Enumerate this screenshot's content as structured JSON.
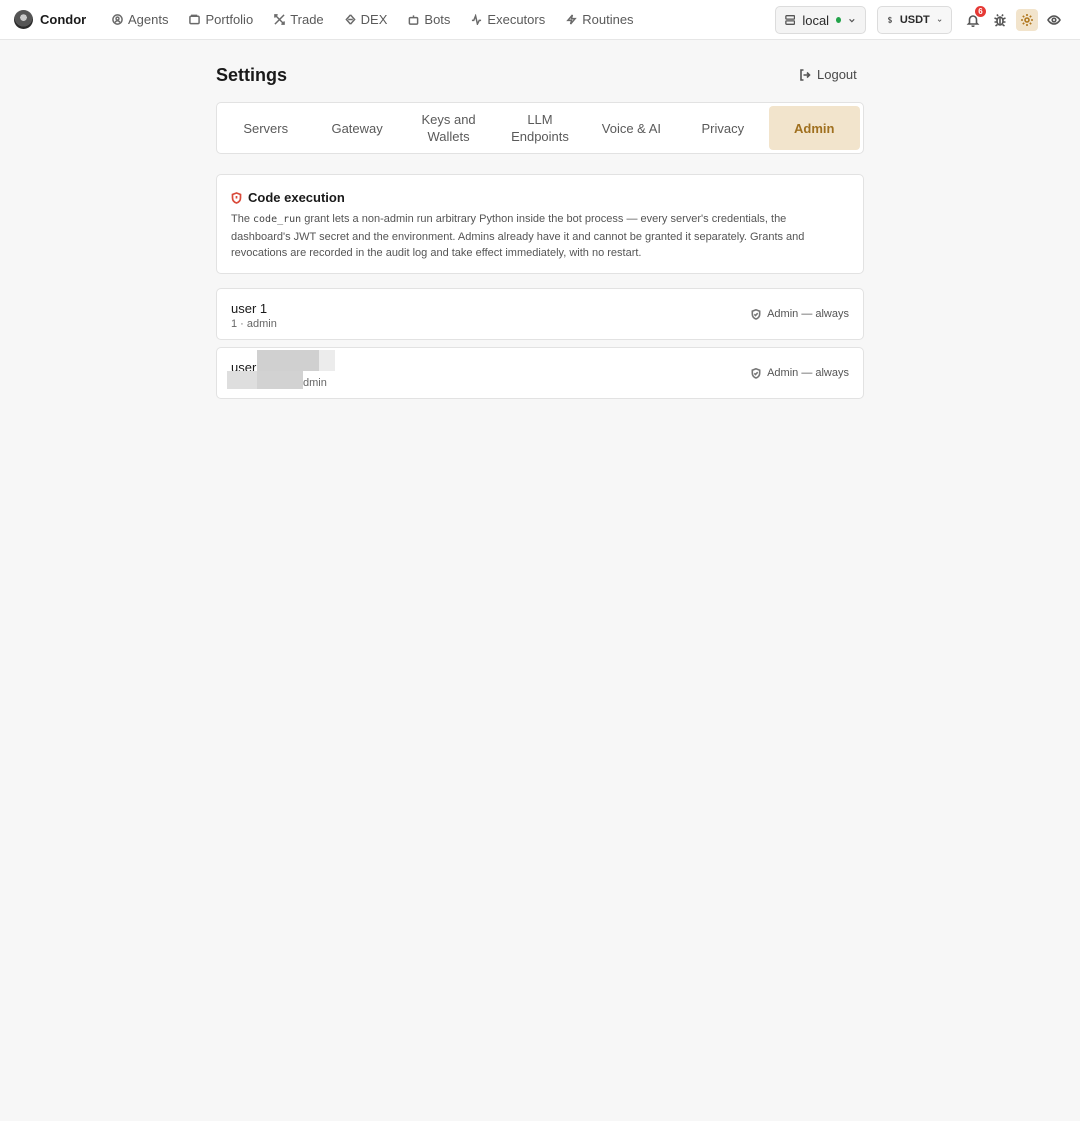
{
  "app": {
    "brand": "Condor"
  },
  "nav": {
    "items": [
      {
        "label": "Agents",
        "icon": "agents-icon"
      },
      {
        "label": "Portfolio",
        "icon": "portfolio-icon"
      },
      {
        "label": "Trade",
        "icon": "trade-icon"
      },
      {
        "label": "DEX",
        "icon": "dex-icon"
      },
      {
        "label": "Bots",
        "icon": "bots-icon"
      },
      {
        "label": "Executors",
        "icon": "executors-icon"
      },
      {
        "label": "Routines",
        "icon": "routines-icon"
      }
    ],
    "server": {
      "label": "local",
      "status_color": "#22a34a"
    },
    "currency": {
      "label": "USDT"
    },
    "notifications_count": "6"
  },
  "page": {
    "title": "Settings",
    "logout_label": "Logout"
  },
  "tabs": {
    "items": [
      {
        "label": "Servers"
      },
      {
        "label": "Gateway"
      },
      {
        "label": "Keys and Wallets"
      },
      {
        "label": "LLM Endpoints"
      },
      {
        "label": "Voice & AI"
      },
      {
        "label": "Privacy"
      },
      {
        "label": "Admin"
      }
    ],
    "active": "Admin"
  },
  "code_execution": {
    "title": "Code execution",
    "body_pre": "The ",
    "body_code": "code_run",
    "body_post": " grant lets a non-admin run arbitrary Python inside the bot process — every server's credentials, the dashboard's JWT secret and the environment. Admins already have it and cannot be granted it separately. Grants and revocations are recorded in the audit log and take effect immediately, with no restart."
  },
  "users": [
    {
      "name": "user 1",
      "meta": "1 · admin",
      "status": "Admin — always"
    },
    {
      "name": "user",
      "meta": "dmin",
      "status": "Admin — always"
    }
  ],
  "colors": {
    "accent_bg": "#f2e4cc",
    "accent_text": "#a0701f",
    "badge": "#e53935"
  }
}
